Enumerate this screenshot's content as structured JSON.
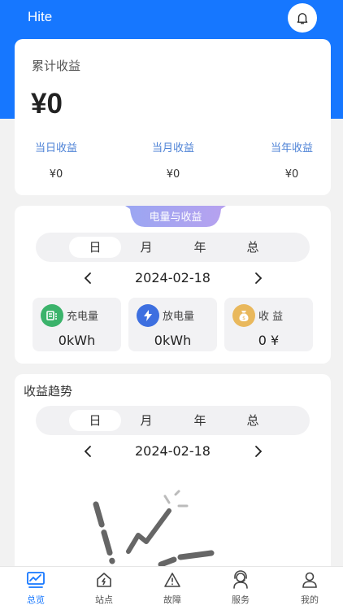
{
  "app": {
    "title": "Hite"
  },
  "earnings": {
    "title": "累计收益",
    "total": "¥0",
    "stats": [
      {
        "label": "当日收益",
        "value": "¥0"
      },
      {
        "label": "当月收益",
        "value": "¥0"
      },
      {
        "label": "当年收益",
        "value": "¥0"
      }
    ]
  },
  "energy": {
    "ribbon": "电量与收益",
    "tabs": [
      "日",
      "月",
      "年",
      "总"
    ],
    "active_tab": "日",
    "date": "2024-02-18",
    "metrics": [
      {
        "label": "充电量",
        "value": "0kWh",
        "icon": "battery-charge-icon",
        "color": "#3bb36b"
      },
      {
        "label": "放电量",
        "value": "0kWh",
        "icon": "lightning-icon",
        "color": "#3d6fe0"
      },
      {
        "label": "收 益",
        "value": "0 ¥",
        "icon": "money-bag-icon",
        "color": "#e9b85c"
      }
    ]
  },
  "trend": {
    "title": "收益趋势",
    "tabs": [
      "日",
      "月",
      "年",
      "总"
    ],
    "active_tab": "日",
    "date": "2024-02-18"
  },
  "tabbar": {
    "items": [
      {
        "label": "总览",
        "icon": "dashboard-icon",
        "active": true
      },
      {
        "label": "站点",
        "icon": "station-home-icon",
        "active": false
      },
      {
        "label": "故障",
        "icon": "warning-icon",
        "active": false
      },
      {
        "label": "服务",
        "icon": "support-agent-icon",
        "active": false
      },
      {
        "label": "我的",
        "icon": "user-icon",
        "active": false
      }
    ]
  },
  "colors": {
    "primary": "#1677ff",
    "stat_label": "#4d82d6",
    "background": "#f2f2f2"
  }
}
